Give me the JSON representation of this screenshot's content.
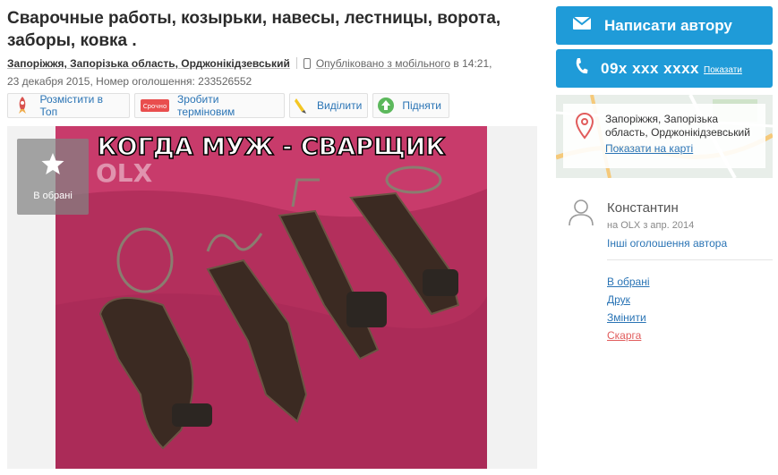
{
  "ad": {
    "title": "Сварочные работы, козырьки, навесы, лестницы, ворота, заборы, ковка .",
    "location": "Запоріжжя, Запорізька область, Орджонікідзевський",
    "mobile_prefix": "Опубліковано з мобільного",
    "mobile_suffix": "в 14:21,",
    "date_line": "23 декабря 2015, Номер оголошення: 233526552"
  },
  "actions": [
    {
      "label": "Розмістити в Топ",
      "icon": "rocket-icon"
    },
    {
      "label": "Зробити терміновим",
      "icon": "urgent-tag-icon",
      "badge": "Срочно"
    },
    {
      "label": "Виділити",
      "icon": "highlighter-icon"
    },
    {
      "label": "Підняти",
      "icon": "up-arrow-icon"
    }
  ],
  "gallery": {
    "photo_caption": "КОГДА МУЖ - СВАРЩИК",
    "watermark": "OLX",
    "favorite_label": "В обрані"
  },
  "contact": {
    "write_label": "Написати автору",
    "phone_masked": "09x xxx xxxx",
    "show_label": "Показати"
  },
  "map": {
    "address": "Запоріжжя, Запорізька область, Орджонікідзевський",
    "show_on_map": "Показати на карті"
  },
  "seller": {
    "name": "Константин",
    "since": "на OLX з апр. 2014",
    "other_ads": "Інші оголошення автора"
  },
  "links": {
    "favorite": "В обрані",
    "print": "Друк",
    "edit": "Змінити",
    "report": "Скарга"
  },
  "colors": {
    "accent": "#1f9bd8",
    "link": "#2a74b5",
    "danger": "#e15c5c"
  }
}
